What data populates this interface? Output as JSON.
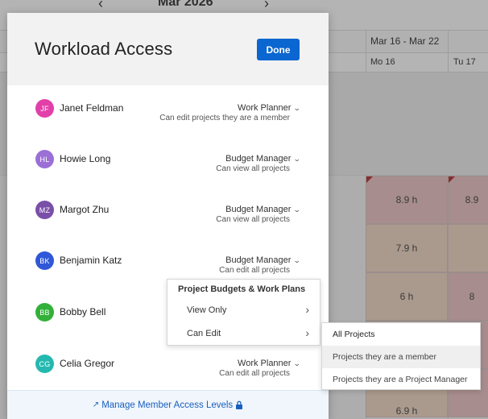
{
  "background": {
    "month": "Mar 2026",
    "week_label": "Mar 16 - Mar 22",
    "days": [
      "Mo 16",
      "Tu 17"
    ],
    "cells": [
      "8.9 h",
      "8.9",
      "7.9 h",
      "6 h",
      "8",
      "6.9 h"
    ]
  },
  "modal": {
    "title": "Workload Access",
    "done_label": "Done",
    "members": [
      {
        "initials": "JF",
        "name": "Janet Feldman",
        "role": "Work Planner",
        "desc": "Can edit projects they are a member",
        "color": "#e33fa8"
      },
      {
        "initials": "HL",
        "name": "Howie Long",
        "role": "Budget Manager",
        "desc": "Can view all projects",
        "color": "#9b6fd6"
      },
      {
        "initials": "MZ",
        "name": "Margot Zhu",
        "role": "Budget Manager",
        "desc": "Can view all projects",
        "color": "#7a4fa8"
      },
      {
        "initials": "BK",
        "name": "Benjamin Katz",
        "role": "Budget Manager",
        "desc": "Can edit all projects",
        "color": "#2f57d8"
      },
      {
        "initials": "BB",
        "name": "Bobby Bell",
        "role": "",
        "desc": "",
        "color": "#33b03a"
      },
      {
        "initials": "CG",
        "name": "Celia Gregor",
        "role": "Work Planner",
        "desc": "Can edit all projects",
        "color": "#25b8b0"
      }
    ],
    "footer_link": "Manage Member Access Levels"
  },
  "permission_menu": {
    "title": "Project Budgets & Work Plans",
    "items": [
      "View Only",
      "Can Edit"
    ]
  },
  "scope_menu": {
    "options": [
      "All Projects",
      "Projects they are a member",
      "Projects they are a Project Manager"
    ]
  }
}
